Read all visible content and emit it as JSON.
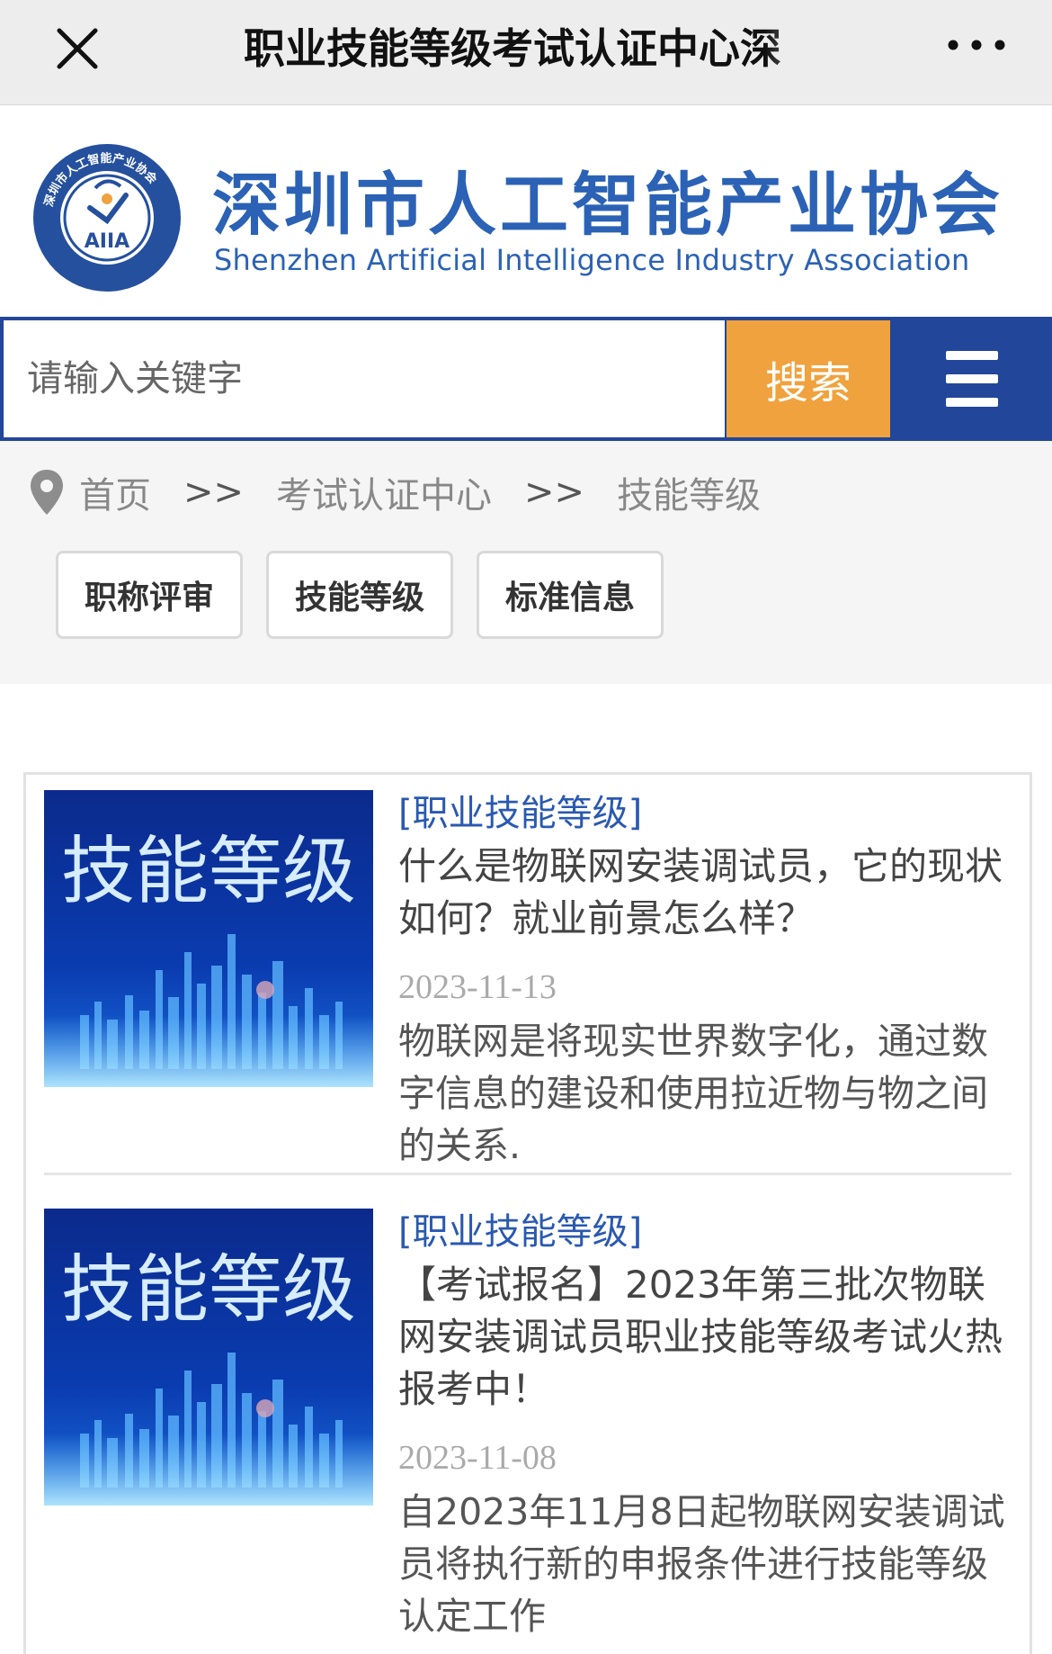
{
  "window": {
    "title": "职业技能等级考试认证中心深"
  },
  "header": {
    "logo_name_cn": "深圳市人工智能产业协会",
    "logo_name_en": "Shenzhen Artificial Intelligence Industry Association",
    "badge_ring_text": "深圳市人工智能产业协会",
    "badge_inner_text": "AIIA"
  },
  "search": {
    "placeholder": "请输入关键字",
    "button_label": "搜索"
  },
  "breadcrumb": {
    "home": "首页",
    "separator": ">>",
    "level1": "考试认证中心",
    "level2": "技能等级"
  },
  "tags": [
    "职称评审",
    "技能等级",
    "标准信息"
  ],
  "articles": [
    {
      "thumb_text": "技能等级",
      "category": "[职业技能等级]",
      "title": "什么是物联网安装调试员，它的现状如何？就业前景怎么样？",
      "date": "2023-11-13",
      "summary": "物联网是将现实世界数字化，通过数字信息的建设和使用拉近物与物之间的关系."
    },
    {
      "thumb_text": "技能等级",
      "category": "[职业技能等级]",
      "title": "【考试报名】2023年第三批次物联网安装调试员职业技能等级考试火热报考中！",
      "date": "2023-11-08",
      "summary": "自2023年11月8日起物联网安装调试员将执行新的申报条件进行技能等级认定工作"
    }
  ],
  "colors": {
    "brand_blue": "#2b62b5",
    "search_bar": "#22469a",
    "search_button": "#f0a23e",
    "category_link": "#2a59b0"
  }
}
